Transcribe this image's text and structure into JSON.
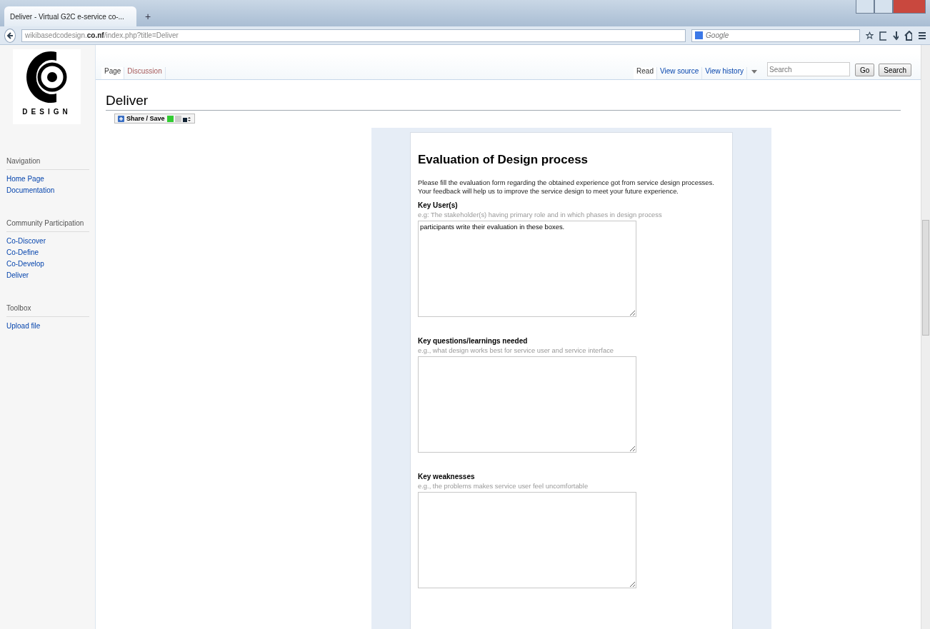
{
  "browser": {
    "tab_title": "Deliver - Virtual G2C e-service co-...",
    "new_tab": "+",
    "url": {
      "host": "wikibasedcodesign.",
      "domain": "co.nf",
      "path": "/index.php?title=Deliver"
    },
    "search_placeholder": "Google"
  },
  "logo": {
    "text": "DESIGN"
  },
  "sidebar": {
    "sections": [
      {
        "title": "Navigation",
        "items": [
          "Home Page",
          "Documentation"
        ]
      },
      {
        "title": "Community Participation",
        "items": [
          "Co-Discover",
          "Co-Define",
          "Co-Develop",
          "Deliver"
        ]
      },
      {
        "title": "Toolbox",
        "items": [
          "Upload file"
        ]
      }
    ]
  },
  "page_tabs": [
    {
      "label": "Page",
      "selected": true
    },
    {
      "label": "Discussion",
      "selected": false
    }
  ],
  "view_tabs": [
    {
      "label": "Read",
      "selected": true
    },
    {
      "label": "View source",
      "selected": false
    },
    {
      "label": "View history",
      "selected": false
    }
  ],
  "search": {
    "placeholder": "Search",
    "buttons": [
      "Go",
      "Search"
    ]
  },
  "title": "Deliver",
  "share": {
    "label": "Share / Save"
  },
  "form": {
    "title": "Evaluation of Design process",
    "intro": "Please fill the evaluation form regarding the obtained experience got from service design processes. Your feedback will help us to improve the service design to meet your future experience.",
    "fields": [
      {
        "label": "Key User(s)",
        "hint": "e.g: The stakeholder(s) having primary role and in which phases in design process",
        "value": "participants write their evaluation in these boxes."
      },
      {
        "label": "Key questions/learnings needed",
        "hint": "e.g., what design works best for service user and service interface"
      },
      {
        "label": "Key weaknesses",
        "hint": "e.g., the problems makes service user feel uncomfortable"
      }
    ]
  }
}
